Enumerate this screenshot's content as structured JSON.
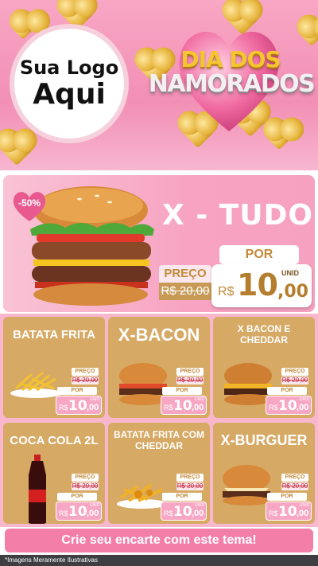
{
  "header": {
    "logo_line1": "Sua Logo",
    "logo_line2": "Aqui",
    "title_line1": "DIA DOS",
    "title_line2": "NAMORADOS"
  },
  "feature": {
    "discount": "-50%",
    "name": "X - TUDO",
    "por_label": "POR",
    "preco_label": "PREÇO",
    "old_price": "R$ 20,00",
    "currency": "R$",
    "price_int": "10",
    "price_dec": ",00",
    "unit": "UNID"
  },
  "labels": {
    "preco": "PREÇO",
    "por": "POR",
    "currency": "R$",
    "price_int": "10",
    "price_dec": ",00",
    "unit": "UNID",
    "old_price": "R$ 20,00"
  },
  "cards": [
    {
      "title": "BATATA FRITA"
    },
    {
      "title": "X-BACON"
    },
    {
      "title": "X BACON E CHEDDAR"
    },
    {
      "title": "COCA COLA 2L"
    },
    {
      "title": "BATATA FRITA COM CHEDDAR"
    },
    {
      "title": "X-BURGUER"
    }
  ],
  "cta": "Crie seu encarte com este tema!",
  "footer": "*Imagens Meramente Ilustrativas",
  "colors": {
    "pink": "#f7a7c3",
    "gold": "#d6a964",
    "brown": "#b57e2e"
  }
}
